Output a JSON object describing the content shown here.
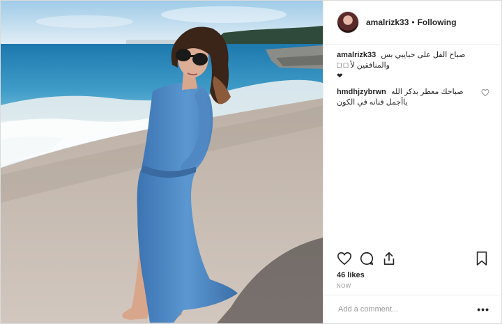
{
  "post": {
    "photo_description_icon": "beach-photo",
    "username": "amalrizk33",
    "follow_status": "Following",
    "separator": "•"
  },
  "comments": [
    {
      "username": "amalrizk33",
      "text": "صباح الفل على حبايبي بس والمنافقين لأ □ □",
      "extra": "❤"
    },
    {
      "username": "hmdhjzybrwn",
      "text": "صباحك معطر بذكر الله ياأجمل فنانه في الكون"
    }
  ],
  "actions": {
    "like_icon": "heart-icon",
    "comment_icon": "comment-icon",
    "share_icon": "share-icon",
    "save_icon": "bookmark-icon"
  },
  "likes_text": "46 likes",
  "timestamp": "NOW",
  "add_comment": {
    "placeholder": "Add a comment..."
  },
  "more_options": "•••",
  "colors": {
    "text": "#262626",
    "muted": "#999999",
    "border": "#efefef",
    "sea": "#2f8fc0",
    "sand": "#cbbfb6",
    "dress": "#4a86c4"
  }
}
